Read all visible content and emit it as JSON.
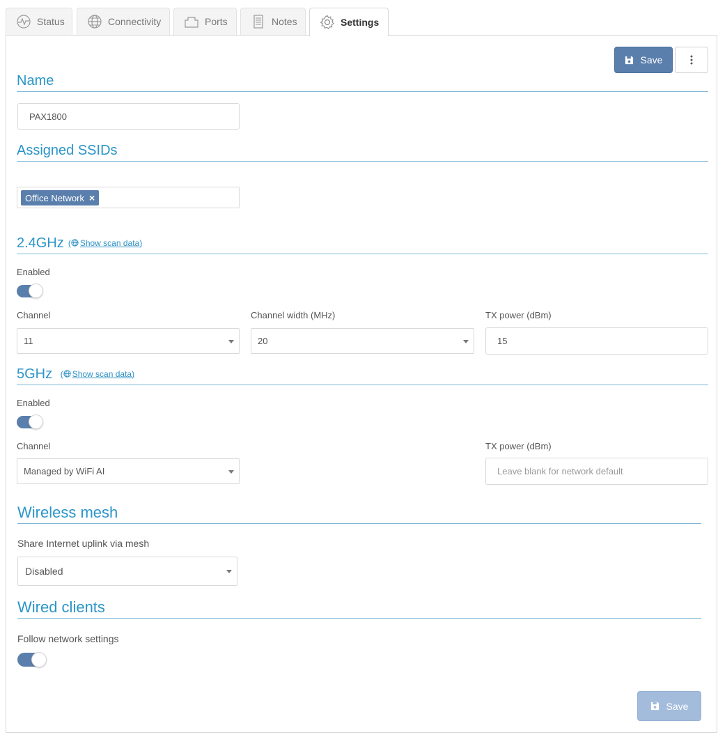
{
  "tabs": [
    {
      "label": "Status",
      "icon": "activity-icon"
    },
    {
      "label": "Connectivity",
      "icon": "globe-icon"
    },
    {
      "label": "Ports",
      "icon": "ports-icon"
    },
    {
      "label": "Notes",
      "icon": "notes-icon"
    },
    {
      "label": "Settings",
      "icon": "gear-icon",
      "active": true
    }
  ],
  "toolbar": {
    "save_label": "Save",
    "more_icon": "vertical-dots-icon"
  },
  "name_section": {
    "title": "Name",
    "value": "PAX1800"
  },
  "ssids_section": {
    "title": "Assigned SSIDs",
    "chips": [
      "Office Network"
    ],
    "chip_remove": "×"
  },
  "band24": {
    "title": "2.4GHz",
    "scan_link": "Show scan data",
    "link_open": "(",
    "link_close": ")",
    "enabled_label": "Enabled",
    "enabled": true,
    "channel_label": "Channel",
    "channel_value": "11",
    "width_label": "Channel width (MHz)",
    "width_value": "20",
    "tx_label": "TX power (dBm)",
    "tx_value": "15"
  },
  "band5": {
    "title": "5GHz",
    "scan_link": "Show scan data",
    "link_open": "(",
    "link_close": ")",
    "enabled_label": "Enabled",
    "enabled": true,
    "channel_label": "Channel",
    "channel_value": "Managed by WiFi AI",
    "tx_label": "TX power (dBm)",
    "tx_placeholder": "Leave blank for network default"
  },
  "mesh": {
    "title": "Wireless mesh",
    "share_label": "Share Internet uplink via mesh",
    "share_value": "Disabled"
  },
  "wired": {
    "title": "Wired clients",
    "follow_label": "Follow network settings",
    "follow_enabled": true
  },
  "footer": {
    "save_label": "Save"
  },
  "colors": {
    "accent": "#2a95c8",
    "primary": "#5a7fac",
    "primary_disabled": "#a3bcdc"
  }
}
